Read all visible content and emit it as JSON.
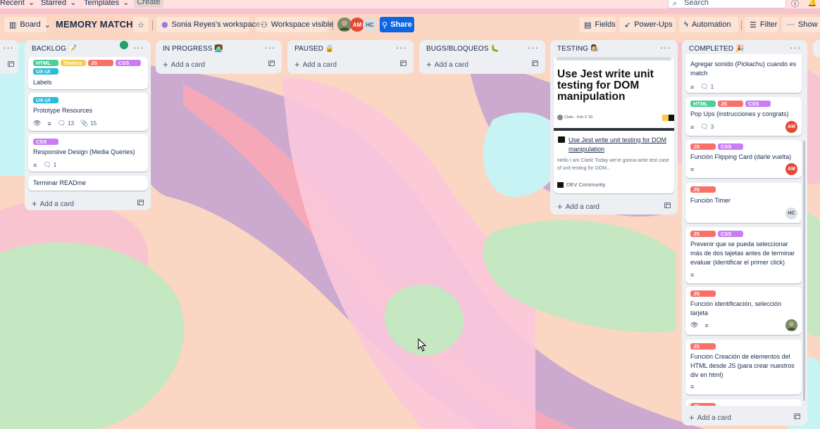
{
  "topbar": {
    "recent": "Recent",
    "starred": "Starred",
    "templates": "Templates",
    "create": "Create",
    "search_placeholder": "Search"
  },
  "board": {
    "view": "Board",
    "title": "MEMORY MATCH",
    "workspace": "Sonia Reyes's workspace",
    "visibility": "Workspace visible",
    "members": [
      "AM",
      "HC"
    ],
    "share": "Share",
    "fields": "Fields",
    "powerups": "Power-Ups",
    "automation": "Automation",
    "filter": "Filter",
    "show_menu": "Show me"
  },
  "colors": {
    "html": "#4bce97",
    "testers": "#f5cd47",
    "js": "#f87168",
    "css": "#c97cf4",
    "uxui": "#2abbd7",
    "avatar_am": "#e34935",
    "avatar_hc": "#dcdfe4",
    "share": "#0c66e4"
  },
  "add_card": "Add a card",
  "lists": {
    "backlog": {
      "title": "BACKLOG 📝",
      "cards": [
        {
          "labels": [
            "HTML",
            "Testers",
            "JS",
            "CSS",
            "UX-UI"
          ],
          "title": "Labels"
        },
        {
          "labels": [
            "UX-UI"
          ],
          "title": "Prototype Resources",
          "comments": "13",
          "attachments": "15"
        },
        {
          "labels": [
            "CSS"
          ],
          "title": "Responsive Design (Media Queries)",
          "comments": "1"
        },
        {
          "labels": [],
          "title": "Terminar READme"
        }
      ]
    },
    "inprogress": {
      "title": "IN PROGRESS 👩‍💻"
    },
    "paused": {
      "title": "PAUSED 🔒"
    },
    "bugs": {
      "title": "BUGS/BLOQUEOS 🐛"
    },
    "testing": {
      "title": "TESTING 👩‍🔬",
      "cover_heading": "Use Jest write unit testing for DOM manipulation",
      "cover_meta": "Clark · Feb 2 '20",
      "link_title": "Use Jest write unit testing for DOM manipulation",
      "link_desc": "Hello I am Clark! Today we're gonna write test case of unit testing for DOM...",
      "source": "DEV Community"
    },
    "completed": {
      "title": "COMPLETED 🎉",
      "cards": [
        {
          "labels": [],
          "title": "Agregar sonido (Pickachu) cuando es match",
          "comments": "1"
        },
        {
          "labels": [
            "HTML",
            "JS",
            "CSS"
          ],
          "title": "Pop Ups (instrucciones y congrats)",
          "comments": "3",
          "member": "AM"
        },
        {
          "labels": [
            "JS",
            "CSS"
          ],
          "title": "Función Flipping Card (darle vuelta)",
          "member": "AM"
        },
        {
          "labels": [
            "JS"
          ],
          "title": "Función Timer",
          "member": "HC"
        },
        {
          "labels": [
            "JS",
            "CSS"
          ],
          "title": "Prevenir que se pueda seleccionar más de dos tajetas antes de terminar evaluar (identificar el primer click)"
        },
        {
          "labels": [
            "JS"
          ],
          "title": "Función identificación, selección tarjeta"
        },
        {
          "labels": [
            "JS"
          ],
          "title": "Función Creación de elementos del HTML desde JS (para crear nuestros div en html)"
        },
        {
          "labels": [
            "JS"
          ],
          "title": ""
        }
      ]
    }
  }
}
